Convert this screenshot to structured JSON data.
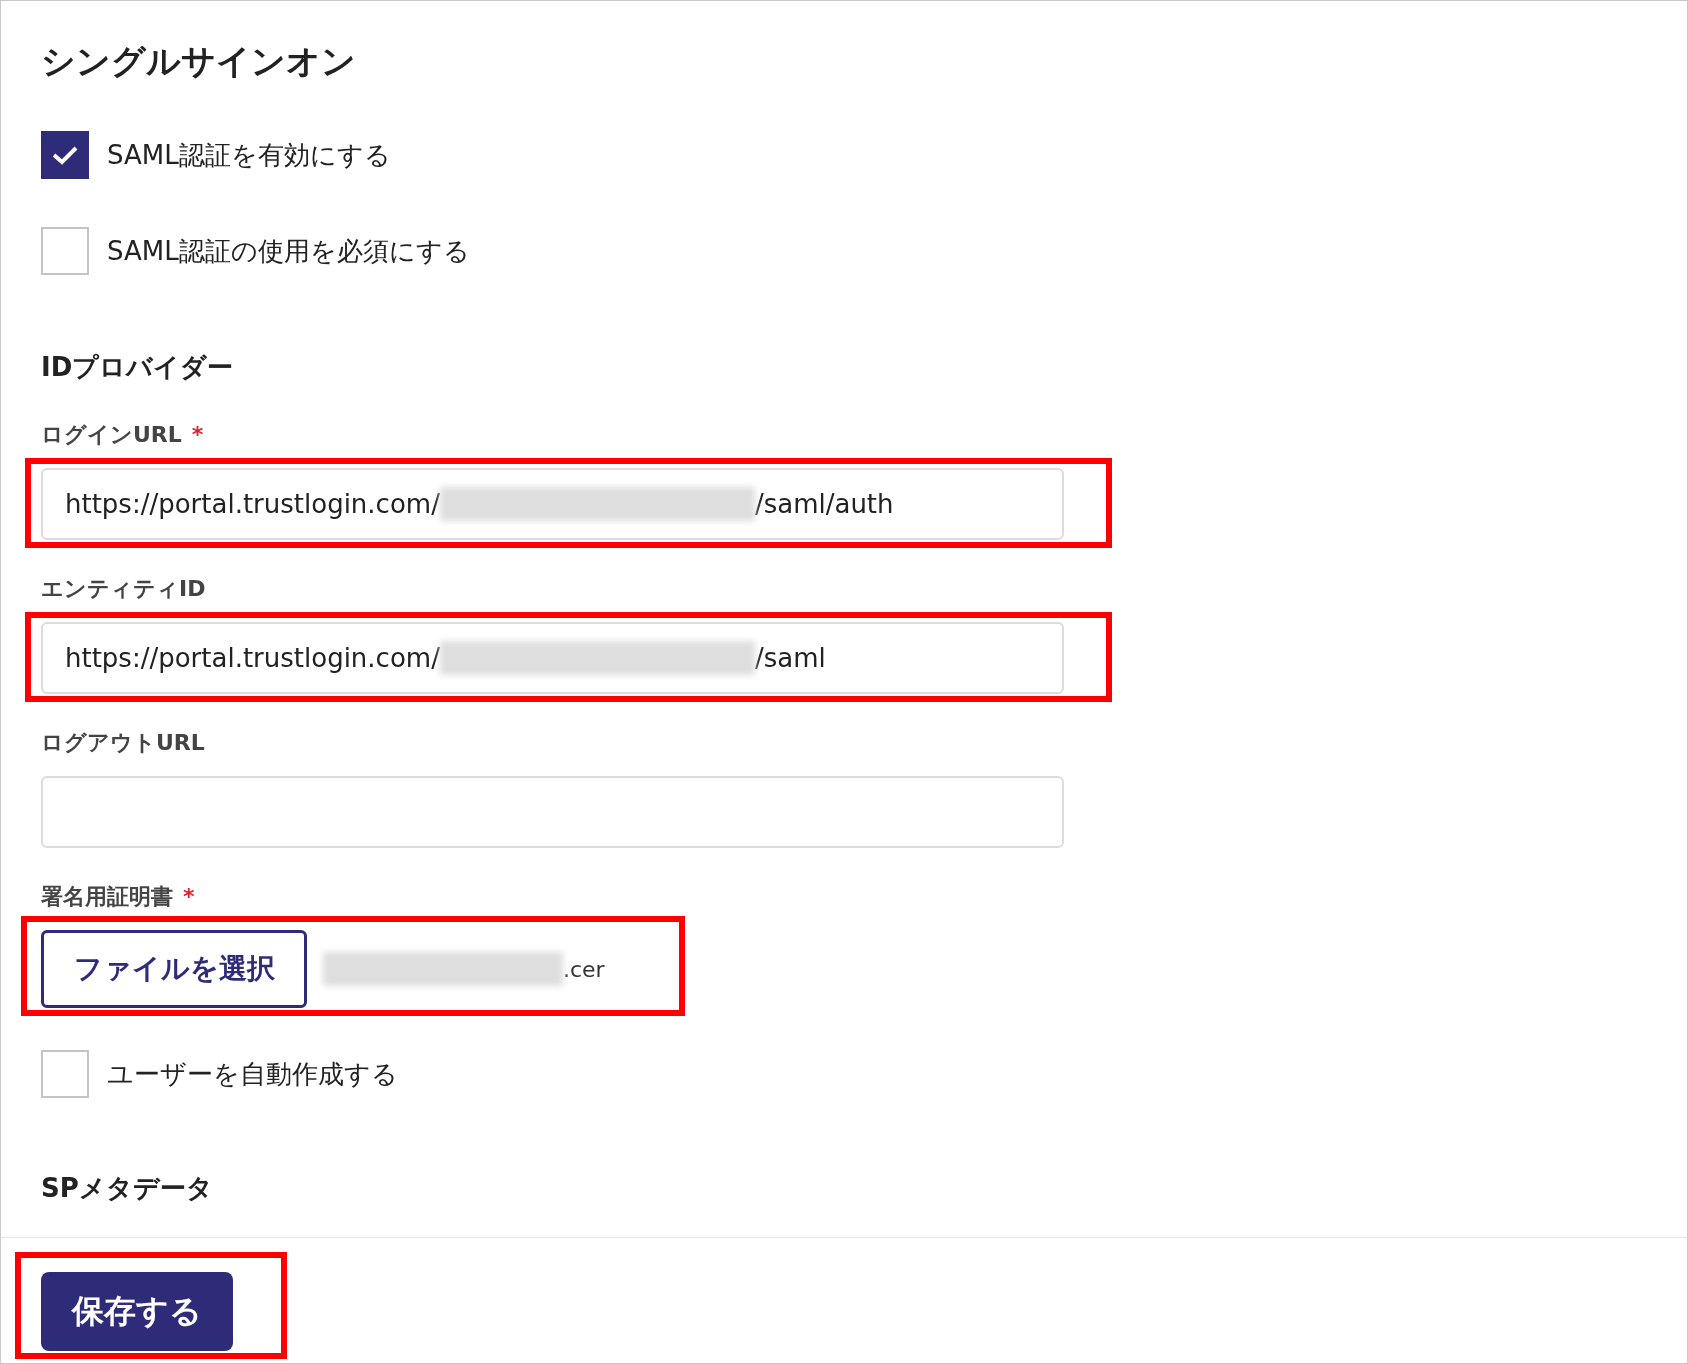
{
  "heading": "シングルサインオン",
  "options": [
    {
      "label": "SAML認証を有効にする",
      "checked": true
    },
    {
      "label": "SAML認証の使用を必須にする",
      "checked": false
    }
  ],
  "idp": {
    "heading": "IDプロバイダー",
    "fields": [
      {
        "label": "ログインURL",
        "required_mark": "*",
        "value_start": "https://portal.trustlogin.com/",
        "value_end": "/saml/auth",
        "redacted": true,
        "highlighted": true
      },
      {
        "label": "エンティティID",
        "value_start": "https://portal.trustlogin.com/",
        "value_end": "/saml",
        "redacted": true,
        "highlighted": true
      },
      {
        "label": "ログアウトURL",
        "redacted": false,
        "highlighted": false
      }
    ],
    "certificate": {
      "label": "署名用証明書",
      "required_mark": "*",
      "button": "ファイルを選択",
      "file_end": ".cer",
      "redacted": true,
      "highlighted": true
    },
    "auto_create": {
      "label": "ユーザーを自動作成する",
      "checked": false
    }
  },
  "sp": {
    "heading": "SPメタデータ"
  },
  "save_button": {
    "label": "保存する",
    "highlighted": true
  }
}
